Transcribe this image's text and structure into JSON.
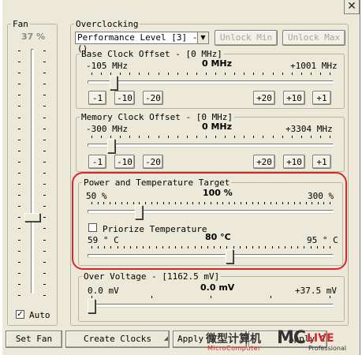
{
  "fan": {
    "title": "Fan",
    "percent": "37 %",
    "level_fraction": 0.37,
    "auto_label": "Auto",
    "auto_checked": true,
    "set_fan_label": "Set Fan"
  },
  "overclocking": {
    "title": "Overclocking",
    "performance_level": "Performance Level [3] - ()",
    "unlock_min_label": "Unlock Min",
    "unlock_max_label": "Unlock Max"
  },
  "base_clock": {
    "title": "Base Clock Offset - [0 MHz]",
    "min": "-105 MHz",
    "current": "0 MHz",
    "max": "+1001 MHz",
    "value": 0,
    "range": [
      -105,
      1001
    ],
    "buttons": [
      "-1",
      "-10",
      "-20",
      "+20",
      "+10",
      "+1"
    ]
  },
  "memory_clock": {
    "title": "Memory Clock Offset - [0 MHz]",
    "min": "-300 MHz",
    "current": "0 MHz",
    "max": "+3304 MHz",
    "value": 0,
    "range": [
      -300,
      3304
    ],
    "buttons": [
      "-1",
      "-10",
      "-20",
      "+20",
      "+10",
      "+1"
    ]
  },
  "power_temp": {
    "title": "Power and Temperature Target",
    "power_min": "50 %",
    "power_current": "100 %",
    "power_max": "300 %",
    "power_value": 100,
    "power_range": [
      50,
      300
    ],
    "priorize_label": "Priorize Temperature",
    "priorize_checked": false,
    "temp_min": "59 ° C",
    "temp_current": "80 °C",
    "temp_max": "95 ° C",
    "temp_value": 80,
    "temp_range": [
      59,
      95
    ]
  },
  "over_voltage": {
    "title": "Over Voltage - [1162.5 mV]",
    "min": "0.0 mV",
    "current": "0.0 mV",
    "max": "+37.5 mV",
    "value": 0,
    "range": [
      0,
      37.5
    ]
  },
  "bottom": {
    "create_clocks_label": "Create Clocks",
    "apply_defaults_label": "Apply D",
    "apply_label": "Apply C"
  },
  "watermark": {
    "cn_text": "微型计算机",
    "en_text": "MicroComputer",
    "brand": "MC",
    "brand2": "LIVE",
    "brand_sub": "Professional"
  },
  "colors": {
    "window_bg": "#ece9d8",
    "highlight_ring": "#d9262c",
    "watermark_accent": "#d9262c"
  }
}
